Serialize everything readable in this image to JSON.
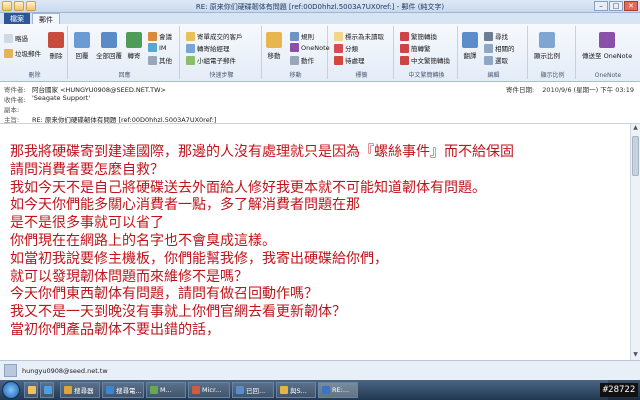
{
  "window": {
    "title": "RE: 原来你们硬碟韌体有問題 [ref:00D0hhzl.5003A7UX0ref:] - 郵件 (純文字)"
  },
  "tabs": {
    "file": "檔案",
    "message": "郵件"
  },
  "ribbon": {
    "delete_group": {
      "ignore": "略過",
      "junk": "垃圾郵件",
      "delete": "刪除",
      "label": "刪除"
    },
    "respond_group": {
      "reply": "回覆",
      "reply_all": "全部回覆",
      "forward": "轉寄",
      "meeting": "會議",
      "im": "IM",
      "more": "其他",
      "label": "回應"
    },
    "quick_group": {
      "q1": "寄單成交的客戶",
      "q2": "轉寄給經理",
      "q3": "小組電子郵件",
      "label": "快速步驟"
    },
    "move_group": {
      "move": "移動",
      "rules": "規則",
      "onenote": "OneNote",
      "actions": "動作",
      "label": "移動"
    },
    "tags_group": {
      "unread": "標示為未讀取",
      "categorize": "分類",
      "followup": "待處理",
      "label": "標籤"
    },
    "chinese_group": {
      "trad_to_simp": "繁簡轉換",
      "simp": "簡轉繁",
      "trad": "中文繁簡轉換",
      "label": "中文繁簡轉換"
    },
    "edit_group": {
      "translate": "翻譯",
      "find": "尋找",
      "related": "相關的",
      "select": "選取",
      "label": "編輯"
    },
    "zoom_group": {
      "zoom": "顯示比例",
      "label": "顯示比例"
    },
    "onenote_group": {
      "send": "傳送至 OneNote",
      "label": "OneNote"
    }
  },
  "header": {
    "from_label": "寄件者:",
    "from_value": "阿台國家 <HUNGYU0908@SEED.NET.TW>",
    "to_label": "收件者:",
    "to_value": "'Seagate Support'",
    "cc_label": "副本:",
    "subject_label": "主旨:",
    "subject_value": "RE: 原来你们硬碟韌体有問題 [ref:00D0hhzl.5003A7UX0ref:]",
    "sent_label": "寄件日期:",
    "sent_value": "2010/9/6 (星期一) 下午 03:19"
  },
  "body": {
    "lines": [
      "那我將硬碟寄到建達國際，那邊的人沒有處理就只是因為『螺絲事件』而不給保固",
      "請問消費者要怎麼自救？",
      "我如今天不是自己將硬碟送去外面給人修好我更本就不可能知道韌体有問題。",
      "如今天你們能多關心消費者一點，多了解消費者問題在那",
      "是不是很多事就可以省了",
      "你們現在在網路上的名字也不會臭成這樣。",
      "如當初我說要修主機板，你們能幫我修，我寄出硬碟給你們，",
      "就可以發現韌体問題而來維修不是嗎？",
      "今天你們東西韌体有問題，請問有做召回動作嗎？",
      "我又不是一天到晚沒有事就上你們官網去看更新韌体？",
      "當初你們產品韌体不要出錯的話，"
    ]
  },
  "people_pane": {
    "email": "hungyu0908@seed.net.tw"
  },
  "taskbar": {
    "items": [
      "搜尋器",
      "搜尋電...",
      "M...",
      "Micr...",
      "已回...",
      "與S...",
      "RE:..."
    ]
  },
  "watermark": "#28722"
}
